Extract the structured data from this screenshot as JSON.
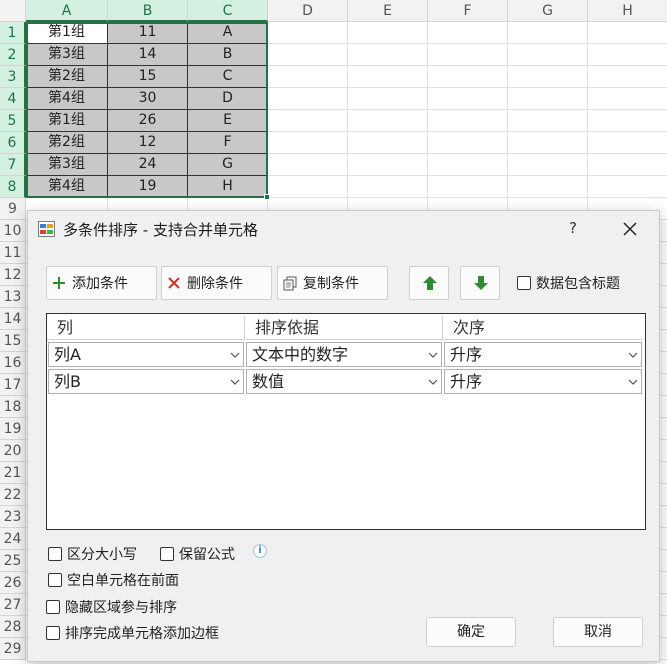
{
  "sheet": {
    "columns": [
      "A",
      "B",
      "C",
      "D",
      "E",
      "F",
      "G",
      "H"
    ],
    "rows": [
      "1",
      "2",
      "3",
      "4",
      "5",
      "6",
      "7",
      "8",
      "9",
      "10",
      "11",
      "12",
      "13",
      "14",
      "15",
      "16",
      "17",
      "18",
      "19",
      "20",
      "21",
      "22",
      "23",
      "24",
      "25",
      "26",
      "27",
      "28",
      "29"
    ],
    "data": [
      [
        "第1组",
        "11",
        "A"
      ],
      [
        "第3组",
        "14",
        "B"
      ],
      [
        "第2组",
        "15",
        "C"
      ],
      [
        "第4组",
        "30",
        "D"
      ],
      [
        "第1组",
        "26",
        "E"
      ],
      [
        "第2组",
        "12",
        "F"
      ],
      [
        "第3组",
        "24",
        "G"
      ],
      [
        "第4组",
        "19",
        "H"
      ]
    ]
  },
  "dialog": {
    "title": "多条件排序 - 支持合并单元格",
    "help": "?",
    "toolbar": {
      "add": "添加条件",
      "delete": "删除条件",
      "copy": "复制条件",
      "header_checkbox": "数据包含标题"
    },
    "grid": {
      "headers": [
        "列",
        "排序依据",
        "次序"
      ],
      "rows": [
        [
          "列A",
          "文本中的数字",
          "升序"
        ],
        [
          "列B",
          "数值",
          "升序"
        ]
      ]
    },
    "options": {
      "case_sensitive": "区分大小写",
      "keep_formula": "保留公式",
      "blank_first": "空白单元格在前面",
      "hidden_sort": "隐藏区域参与排序",
      "add_border": "排序完成单元格添加边框"
    },
    "ok": "确定",
    "cancel": "取消"
  },
  "colors": {
    "excel_green": "#217346",
    "selection_fill": "#c8c8c8",
    "arrow_green": "#2e8b2e"
  }
}
